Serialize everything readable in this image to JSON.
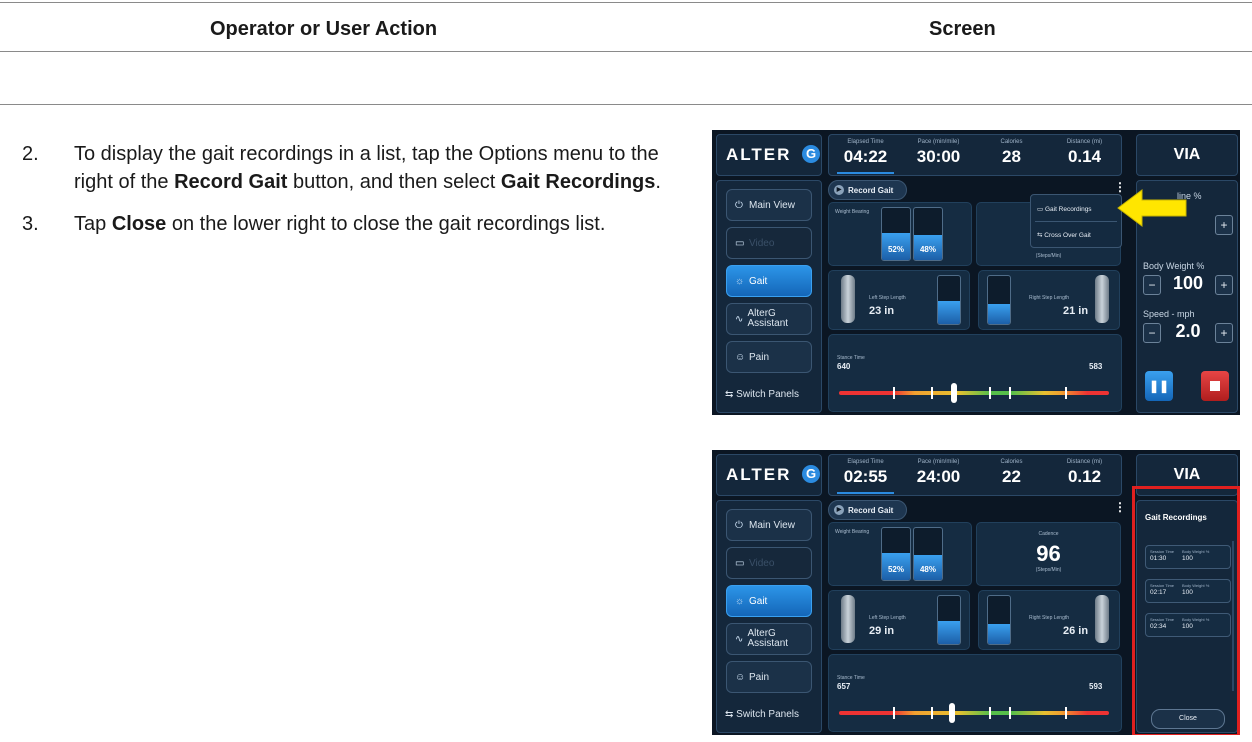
{
  "table": {
    "col_action": "Operator or User Action",
    "col_screen": "Screen"
  },
  "steps": [
    {
      "num": "2.",
      "parts": [
        "To display the gait recordings in a list, tap the Options menu to the right of the ",
        "Record Gait",
        " button, and then select ",
        "Gait Recordings",
        "."
      ]
    },
    {
      "num": "3.",
      "parts": [
        "Tap ",
        "Close",
        " on the lower right to close the gait recordings list."
      ]
    }
  ],
  "screens": [
    {
      "logo": "ALTER",
      "logo_g": "G",
      "stats": [
        {
          "label": "Elapsed Time",
          "value": "04:22"
        },
        {
          "label": "Pace (min/mile)",
          "value": "30:00"
        },
        {
          "label": "Calories",
          "value": "28"
        },
        {
          "label": "Distance (mi)",
          "value": "0.14"
        }
      ],
      "via": "VIA",
      "nav": [
        "Main View",
        "Video",
        "Gait",
        "AlterG Assistant",
        "Pain"
      ],
      "switch_panels": "Switch Panels",
      "record_gait": "Record Gait",
      "weight_bearing": "Weight Bearing",
      "left_pct": "52%",
      "right_pct": "48%",
      "left_pct_value": 52,
      "right_pct_value": 48,
      "cadence_label": "",
      "cadence_value": "",
      "cadence_unit": "(Steps/Min)",
      "left_step_label": "Left Step Length",
      "left_step": "23 in",
      "right_step_label": "Right Step Length",
      "right_step": "21 in",
      "stance_label": "Stance Time",
      "stance_left": "640",
      "stance_right": "583",
      "menu": [
        "Gait Recordings",
        "Cross Over Gait"
      ],
      "incline_label": "line %",
      "bw_label": "Body Weight %",
      "bw_value": "100",
      "speed_label": "Speed - mph",
      "speed_value": "2.0",
      "minus": "−",
      "plus": "+"
    },
    {
      "logo": "ALTER",
      "logo_g": "G",
      "stats": [
        {
          "label": "Elapsed Time",
          "value": "02:55"
        },
        {
          "label": "Pace (min/mile)",
          "value": "24:00"
        },
        {
          "label": "Calories",
          "value": "22"
        },
        {
          "label": "Distance (mi)",
          "value": "0.12"
        }
      ],
      "via": "VIA",
      "nav": [
        "Main View",
        "Video",
        "Gait",
        "AlterG Assistant",
        "Pain"
      ],
      "switch_panels": "Switch Panels",
      "record_gait": "Record Gait",
      "weight_bearing": "Weight Bearing",
      "left_pct": "52%",
      "right_pct": "48%",
      "left_pct_value": 52,
      "right_pct_value": 48,
      "cadence_label": "Cadence",
      "cadence_value": "96",
      "cadence_unit": "(Steps/Min)",
      "left_step_label": "Left Step Length",
      "left_step": "29 in",
      "right_step_label": "Right Step Length",
      "right_step": "26 in",
      "stance_label": "Stance Time",
      "stance_left": "657",
      "stance_right": "593",
      "gait_recordings_title": "Gait Recordings",
      "recordings": [
        {
          "session_label": "Session Time",
          "session": "01:30",
          "bw_label": "Body Weight %",
          "bw": "100"
        },
        {
          "session_label": "Session Time",
          "session": "02:17",
          "bw_label": "Body Weight %",
          "bw": "100"
        },
        {
          "session_label": "Session Time",
          "session": "02:34",
          "bw_label": "Body Weight %",
          "bw": "100"
        }
      ],
      "close": "Close"
    }
  ],
  "colors": {
    "highlight_red": "#e0201f",
    "arrow_yellow": "#ffe600",
    "accent_blue": "#2b8be0"
  }
}
